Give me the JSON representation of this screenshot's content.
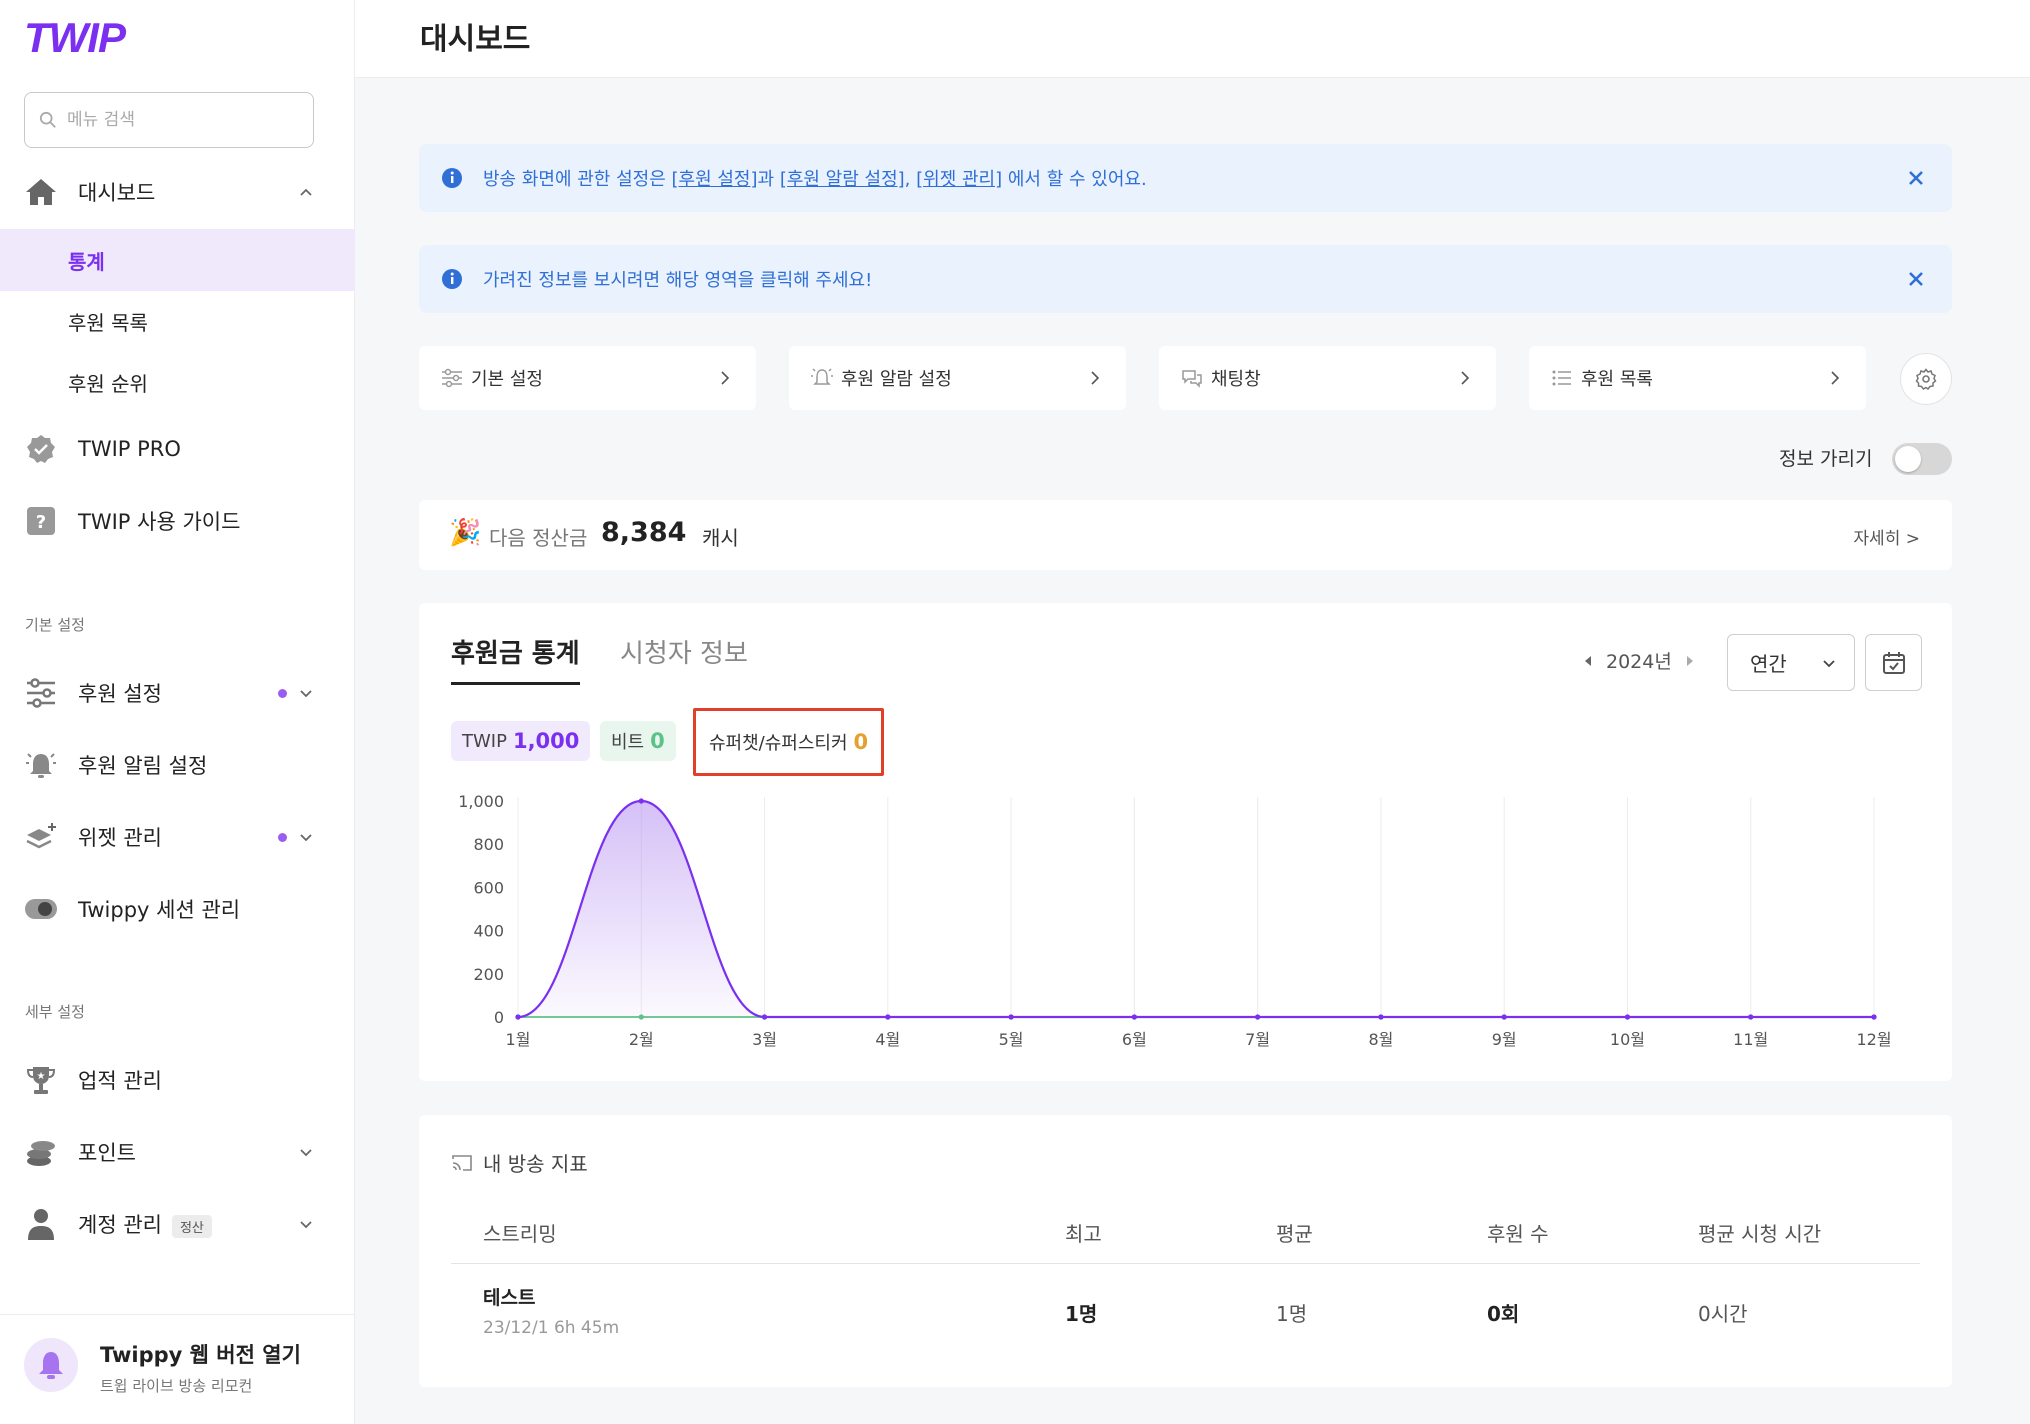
{
  "brand": {
    "logo": "TWIP",
    "accent": "#7b2ff0"
  },
  "sidebar": {
    "search_placeholder": "메뉴 검색",
    "dashboard": {
      "label": "대시보드",
      "children": [
        "통계",
        "후원 목록",
        "후원 순위"
      ],
      "active_child": "통계"
    },
    "pro": "TWIP PRO",
    "guide": "TWIP 사용 가이드",
    "section_basic": "기본 설정",
    "basic_items": [
      "후원 설정",
      "후원 알림 설정",
      "위젯 관리",
      "Twippy 세션 관리"
    ],
    "section_detail": "세부 설정",
    "detail_items": [
      "업적 관리",
      "포인트",
      "계정 관리"
    ],
    "account_badge": "정산",
    "twippy": {
      "title": "Twippy 웹 버전 열기",
      "subtitle": "트윕 라이브 방송 리모컨"
    }
  },
  "header": {
    "title": "대시보드"
  },
  "banners": {
    "first": {
      "prefix": "방송 화면에 관한 설정은 ",
      "link1": "[후원 설정]",
      "mid1": "과 ",
      "link2": "[후원 알람 설정]",
      "mid2": ", ",
      "link3": "[위젯 관리]",
      "suffix": " 에서 할 수 있어요."
    },
    "second": {
      "text": "가려진 정보를 보시려면 해당 영역을 클릭해 주세요!"
    }
  },
  "quick_links": [
    "기본 설정",
    "후원 알람 설정",
    "채팅창",
    "후원 목록"
  ],
  "hide_info": {
    "label": "정보 가리기",
    "on": false
  },
  "settlement": {
    "emoji": "🎉",
    "label": "다음 정산금",
    "amount": "8,384",
    "unit": "캐시",
    "more": "자세히 >"
  },
  "stats": {
    "tabs": [
      "후원금 통계",
      "시청자 정보"
    ],
    "active_tab": "후원금 통계",
    "year": "2024년",
    "period": "연간",
    "pills": {
      "twip": {
        "label": "TWIP",
        "value": "1,000"
      },
      "bits": {
        "label": "비트",
        "value": "0"
      },
      "superchat": {
        "label": "슈퍼챗/슈퍼스티커",
        "value": "0"
      }
    }
  },
  "chart_data": {
    "type": "area",
    "categories": [
      "1월",
      "2월",
      "3월",
      "4월",
      "5월",
      "6월",
      "7월",
      "8월",
      "9월",
      "10월",
      "11월",
      "12월"
    ],
    "series": [
      {
        "name": "TWIP",
        "values": [
          0,
          1000,
          0,
          0,
          0,
          0,
          0,
          0,
          0,
          0,
          0,
          0
        ],
        "color": "#7b2ff0"
      },
      {
        "name": "비트",
        "values": [
          0,
          0,
          0,
          0,
          0,
          0,
          0,
          0,
          0,
          0,
          0,
          0
        ],
        "color": "#5cc287"
      }
    ],
    "y_ticks": [
      "0",
      "200",
      "400",
      "600",
      "800",
      "1,000"
    ],
    "ylim": [
      0,
      1000
    ],
    "grid": "vertical"
  },
  "broadcast": {
    "title": "내 방송 지표",
    "columns": [
      "스트리밍",
      "최고",
      "평균",
      "후원 수",
      "평균 시청 시간"
    ],
    "rows": [
      {
        "name": "테스트",
        "meta": "23/12/1 6h 45m",
        "max": "1명",
        "avg": "1명",
        "donations": "0회",
        "watch_time": "0시간"
      }
    ]
  }
}
